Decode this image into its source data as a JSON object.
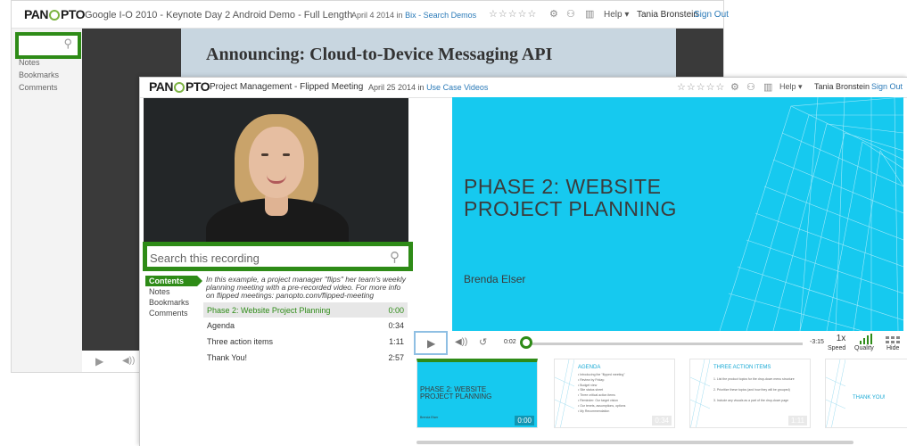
{
  "background_window": {
    "logo": {
      "pre": "PAN",
      "post": "PTO"
    },
    "title": "Google I-O 2010 - Keynote Day 2 Android Demo - Full Length",
    "date": "April 4 2014 in",
    "folder_link": "Bix - Search Demos",
    "stars": "☆☆☆☆☆",
    "help": "Help ▾",
    "user": "Tania Bronstein",
    "sign_out": "Sign Out",
    "nav": [
      "Notes",
      "Bookmarks",
      "Comments"
    ],
    "slide_title": "Announcing: Cloud-to-Device Messaging API"
  },
  "foreground_window": {
    "logo": {
      "pre": "PAN",
      "post": "PTO"
    },
    "title": "Project Management - Flipped Meeting",
    "date": "April 25 2014 in",
    "folder_link": "Use Case Videos",
    "stars": "☆☆☆☆☆",
    "help": "Help ▾",
    "user": "Tania Bronstein",
    "sign_out": "Sign Out",
    "search_placeholder": "Search this recording",
    "nav": {
      "contents": "Contents",
      "notes": "Notes",
      "bookmarks": "Bookmarks",
      "comments": "Comments"
    },
    "description": "In this example, a project manager \"flips\" her team's weekly planning meeting with a pre-recorded video. For more info on flipped meetings: panopto.com/flipped-meeting",
    "toc": [
      {
        "title": "Phase 2: Website Project Planning",
        "time": "0:00"
      },
      {
        "title": "Agenda",
        "time": "0:34"
      },
      {
        "title": "Three action items",
        "time": "1:11"
      },
      {
        "title": "Thank You!",
        "time": "2:57"
      }
    ],
    "slide": {
      "title_line1": "PHASE 2: WEBSITE",
      "title_line2": "PROJECT PLANNING",
      "author": "Brenda Elser"
    },
    "controls": {
      "elapsed": "0:02",
      "remaining": "-3:15",
      "speed_value": "1x",
      "speed_label": "Speed",
      "quality_label": "Quality",
      "hide_label": "Hide",
      "progress": 0.01
    },
    "thumbnails": [
      {
        "title_line1": "PHASE 2: WEBSITE",
        "title_line2": "PROJECT PLANNING",
        "author": "Brenda Elser",
        "time": "0:00"
      },
      {
        "heading": "AGENDA",
        "bullets": [
          "• Introducing the \"flipped meeting\"",
          "• Review by Friday:",
          "   • Budget view",
          "   • Site status sheet",
          "• Three critical action items",
          "• Reminder: Our target vision",
          "• Our tenets, assumptions, options",
          "• My Recommendation"
        ],
        "time": "0:34"
      },
      {
        "heading": "THREE ACTION ITEMS",
        "bullets": [
          "1. List the product topics for the drop-down menu structure",
          "2. Prioritize these topics (and how they will be grouped)",
          "3. Include any visuals as a part of the drop-down page"
        ],
        "time": "1:11"
      },
      {
        "heading": "THANK YOU!",
        "time": ""
      }
    ]
  },
  "colors": {
    "accent_green": "#2e8b17",
    "slide_cyan": "#16c9ef",
    "link_blue": "#2a7ab8",
    "play_focus": "#8fbfe3"
  }
}
